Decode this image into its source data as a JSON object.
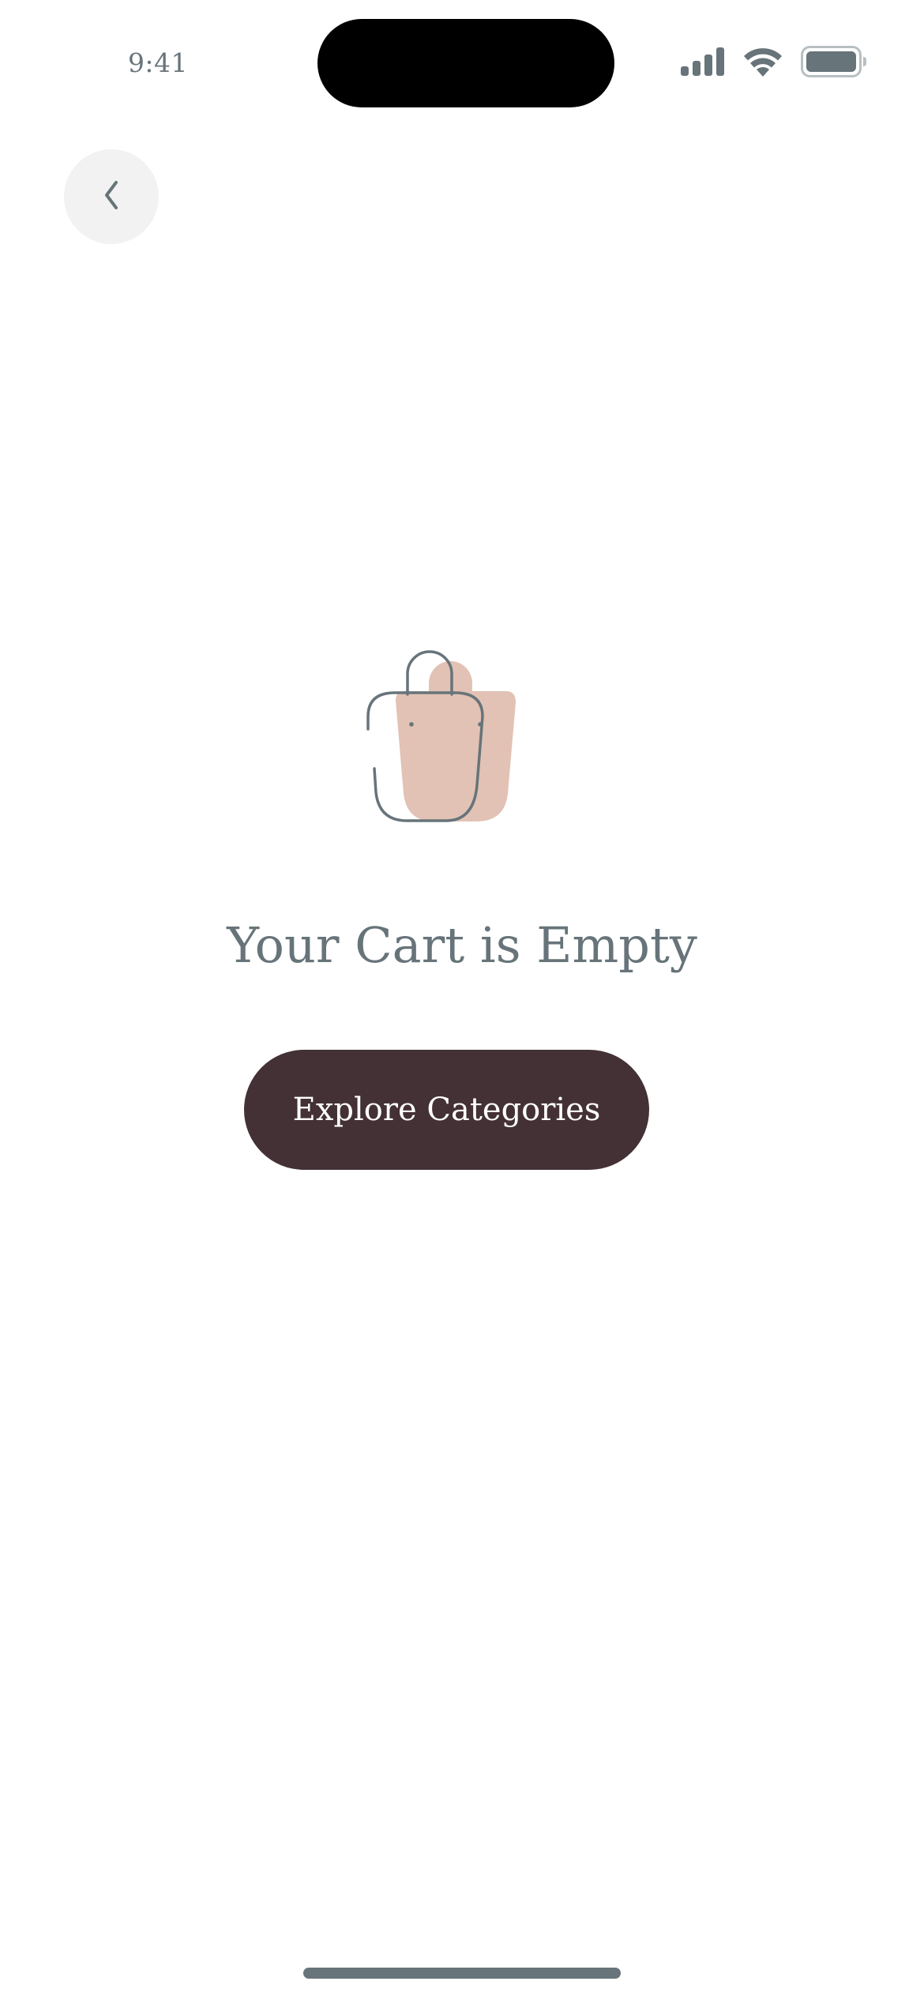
{
  "status_bar": {
    "time": "9:41",
    "icons": [
      "cellular-signal-icon",
      "wifi-icon",
      "battery-icon"
    ],
    "icon_color": "#67747a"
  },
  "navigation": {
    "back_icon": "chevron-left-icon"
  },
  "empty_state": {
    "illustration": "shopping-bag-icon",
    "title": "Your Cart is Empty",
    "cta_label": "Explore Categories"
  },
  "colors": {
    "text_muted": "#67747a",
    "primary_button": "#433135",
    "illustration_fill": "#e2c2b4",
    "back_button_bg": "#f2f2f2",
    "background": "#ffffff"
  }
}
